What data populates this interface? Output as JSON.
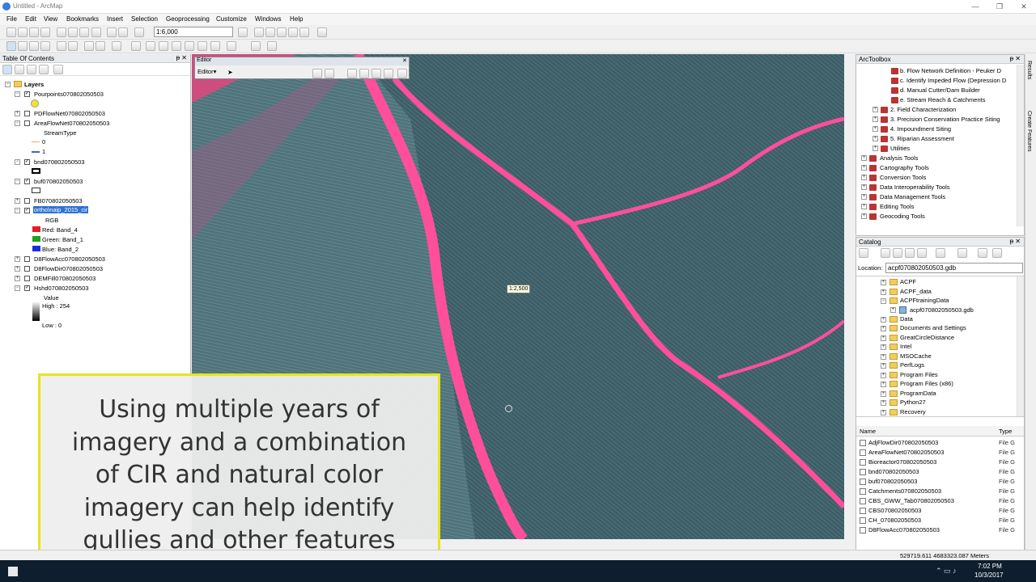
{
  "window": {
    "title": "Untitled - ArcMap"
  },
  "menu": [
    "File",
    "Edit",
    "View",
    "Bookmarks",
    "Insert",
    "Selection",
    "Geoprocessing",
    "Customize",
    "Windows",
    "Help"
  ],
  "toolbar": {
    "scale_value": "1:6,000"
  },
  "toc": {
    "title": "Table Of Contents",
    "root": "Layers",
    "layers": [
      "Pourpoints070802050503",
      "PDFlowNet070802050503",
      "AreaFlowNet070802050503",
      "bnd070802050503",
      "buf070802050503",
      "FB070802050503",
      "ortho\\naip_2015_cir",
      "D8FlowAcc070802050503",
      "D8FlowDir070802050503",
      "DEMFill070802050503",
      "Hshd070802050503"
    ],
    "streamtype_label": "StreamType",
    "streamtype_values": [
      "0",
      "1"
    ],
    "rgb_label": "RGB",
    "bands": [
      "Red:   Band_4",
      "Green: Band_1",
      "Blue:  Band_2"
    ],
    "hshd_value_label": "Value",
    "hshd_high": "High : 254",
    "hshd_low": "Low : 0"
  },
  "editor": {
    "title": "Editor",
    "menu_label": "Editor▾"
  },
  "map": {
    "scale_tip": "1:2,500"
  },
  "caption": {
    "lines": [
      "Using multiple years of",
      "imagery and a combination",
      "of CIR and natural color",
      "imagery can help identify",
      "gullies and other features"
    ]
  },
  "arctoolbox": {
    "title": "ArcToolbox",
    "sub_items": [
      "b. Flow Network Definition - Peuker D",
      "c. Identify Impeded Flow (Depression D",
      "d. Manual Cutter/Dam Builder",
      "e. Stream Reach & Catchments"
    ],
    "groups": [
      "2. Field Characterization",
      "3. Precision Conservation Practice Siting",
      "4. Impoundment Siting",
      "5. Riparian Assessment",
      "Utilities"
    ],
    "toolboxes": [
      "Analysis Tools",
      "Cartography Tools",
      "Conversion Tools",
      "Data Interoperability Tools",
      "Data Management Tools",
      "Editing Tools",
      "Geocoding Tools"
    ]
  },
  "catalog": {
    "title": "Catalog",
    "location_label": "Location:",
    "location_value": "acpf070802050503.gdb",
    "tree": [
      "ACPF",
      "ACPF_data",
      "ACPFtrainingData",
      "acpf070802050503.gdb",
      "Data",
      "Documents and Settings",
      "GreatCircleDistance",
      "Intel",
      "MSOCache",
      "PerfLogs",
      "Program Files",
      "Program Files (x86)",
      "ProgramData",
      "Python27",
      "Recovery"
    ],
    "list_headers": [
      "Name",
      "Type"
    ],
    "files": [
      "AdjFlowDir070802050503",
      "AreaFlowNet070802050503",
      "Bioreactor070802050503",
      "bnd070802050503",
      "buf070802050503",
      "Catchments070802050503",
      "CBS_GWW_Tab070802050503",
      "CBS070802050503",
      "CH_070802050503",
      "D8FlowAcc070802050503"
    ],
    "file_type": "File G"
  },
  "side_tabs": [
    "Results",
    "Create Features"
  ],
  "status": {
    "coords": "529719.611  4683323.087 Meters"
  },
  "taskbar": {
    "time": "7:02 PM",
    "date": "10/3/2017"
  },
  "colors": {
    "field": "#3d5e66",
    "gully": "#ff4f9a",
    "caption_border": "#e8e41c"
  }
}
